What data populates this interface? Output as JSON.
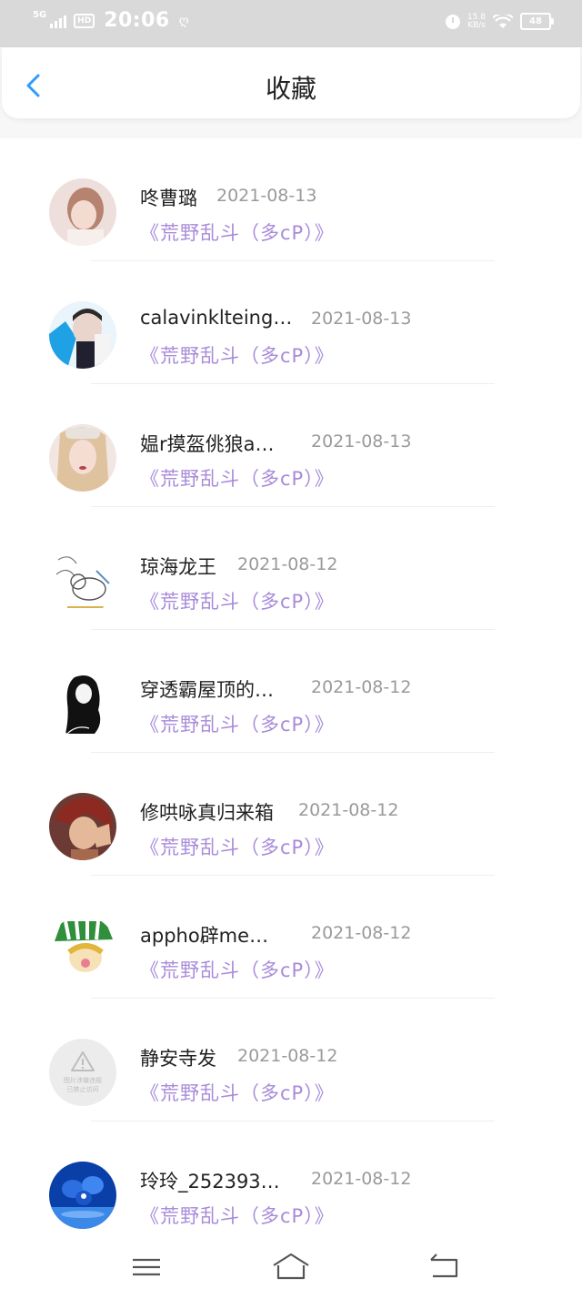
{
  "status_bar": {
    "network": "5G",
    "hd": "HD",
    "time": "20:06",
    "app_icon": "ღ",
    "speed_value": "15.8",
    "speed_unit": "KB/s",
    "battery": "48"
  },
  "header": {
    "title": "收藏",
    "back_icon": "chevron-left-icon",
    "accent_color": "#2f9bff"
  },
  "favorites": [
    {
      "name": "咚曹璐",
      "date": "2021-08-13",
      "book": "《荒野乱斗（多cP）》",
      "avatar": "portrait-girl-1"
    },
    {
      "name": "calavinklteing…",
      "date": "2021-08-13",
      "book": "《荒野乱斗（多cP）》",
      "avatar": "cosplay-boy"
    },
    {
      "name": "媪r摸盔佻狼a…",
      "date": "2021-08-13",
      "book": "《荒野乱斗（多cP）》",
      "avatar": "portrait-girl-2"
    },
    {
      "name": "琼海龙王",
      "date": "2021-08-12",
      "book": "《荒野乱斗（多cP）》",
      "avatar": "sketch-cat"
    },
    {
      "name": "穿透霸屋顶的…",
      "date": "2021-08-12",
      "book": "《荒野乱斗（多cP）》",
      "avatar": "anime-silhouette"
    },
    {
      "name": "修哄咏真归来箱",
      "date": "2021-08-12",
      "book": "《荒野乱斗（多cP）》",
      "avatar": "anime-red-hair"
    },
    {
      "name": "appho辟me…",
      "date": "2021-08-12",
      "book": "《荒野乱斗（多cP）》",
      "avatar": "anime-green-hat"
    },
    {
      "name": "静安寺发",
      "date": "2021-08-12",
      "book": "《荒野乱斗（多cP）》",
      "avatar": "image-blocked-placeholder",
      "placeholder_line1": "图片涉嫌违规",
      "placeholder_line2": "已禁止访问"
    },
    {
      "name": "玲玲_252393…",
      "date": "2021-08-12",
      "book": "《荒野乱斗（多cP）》",
      "avatar": "blue-orchid"
    }
  ],
  "colors": {
    "book_title": "#a98bd9",
    "date": "#9a9a9a",
    "name": "#222222"
  },
  "nav_bar": {
    "menu_icon": "menu-icon",
    "home_icon": "home-icon",
    "back_icon": "return-icon"
  }
}
